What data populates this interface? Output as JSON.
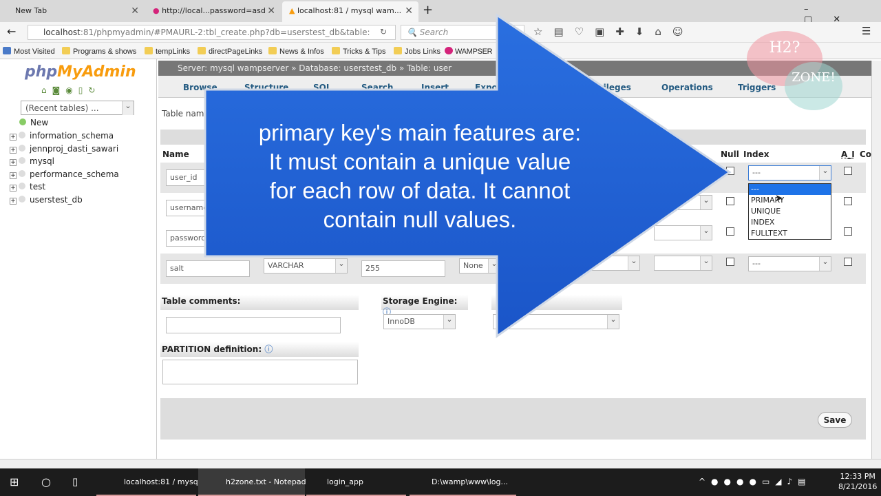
{
  "browser": {
    "tabs": [
      {
        "label": "New Tab"
      },
      {
        "label": "http://local...password=asd"
      },
      {
        "label": "localhost:81 / mysql wam..."
      }
    ],
    "url_host": "localhost",
    "url_rest": ":81/phpmyadmin/#PMAURL-2:tbl_create.php?db=userstest_db&table:",
    "search_placeholder": "Search",
    "bookmarks": [
      "Most Visited",
      "Programs & shows",
      "tempLinks",
      "directPageLinks",
      "News & Infos",
      "Tricks & Tips",
      "Jobs Links",
      "WAMPSER"
    ]
  },
  "pma": {
    "logo_a": "php",
    "logo_b": "MyAdmin",
    "recent": "(Recent tables) ...",
    "databases": [
      "New",
      "information_schema",
      "jennproj_dasti_sawari",
      "mysql",
      "performance_schema",
      "test",
      "userstest_db"
    ],
    "breadcrumb": "Server: mysql wampserver » Database: userstest_db » Table: user",
    "tabs": [
      "Browse",
      "Structure",
      "SQL",
      "Search",
      "Insert",
      "Expo",
      "Privileges",
      "Operations",
      "Triggers"
    ],
    "table_name_label": "Table name",
    "headers": {
      "name": "Name",
      "null": "Null",
      "index": "Index",
      "ai": "A_I",
      "comments": "Co"
    },
    "rows": [
      {
        "name": "user_id",
        "index": "---"
      },
      {
        "name": "username"
      },
      {
        "name": "password"
      },
      {
        "name": "salt",
        "type": "VARCHAR",
        "length": "255",
        "default": "None",
        "index": "---"
      }
    ],
    "index_options": [
      "---",
      "PRIMARY",
      "UNIQUE",
      "INDEX",
      "FULLTEXT"
    ],
    "table_comments": "Table comments:",
    "storage_engine": "Storage Engine:",
    "engine_value": "InnoDB",
    "partition": "PARTITION definition:",
    "save": "Save"
  },
  "overlay": {
    "lines": [
      "primary key's main features are:",
      "It must contain a unique value",
      "for each row of data. It cannot",
      "contain null values."
    ],
    "color": "#1f5fd6"
  },
  "watermark": {
    "a": "H2?",
    "b": "ZONE!"
  },
  "taskbar": {
    "items": [
      "localhost:81 / mysq...",
      "h2zone.txt - Notepad",
      "login_app",
      "D:\\wamp\\www\\log..."
    ],
    "time": "12:33 PM",
    "date": "8/21/2016"
  }
}
